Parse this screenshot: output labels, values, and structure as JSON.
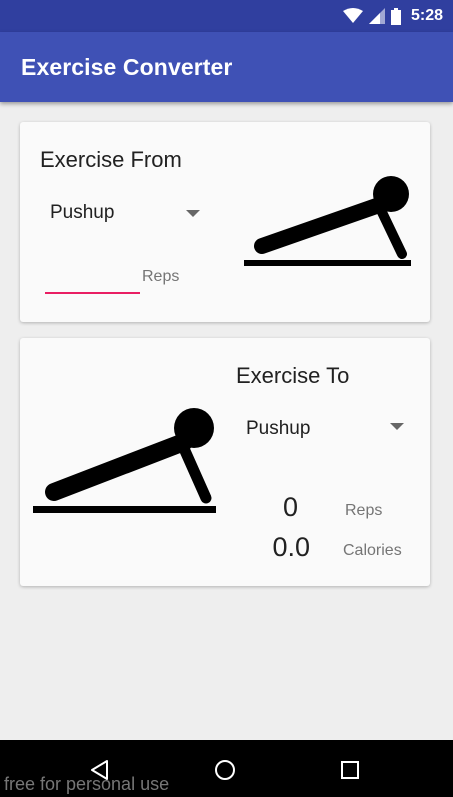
{
  "status_bar": {
    "time": "5:28",
    "icons": [
      "wifi-icon",
      "signal-icon",
      "battery-icon"
    ],
    "color": "#303f9f"
  },
  "app_bar": {
    "title": "Exercise Converter",
    "color": "#3f51b5"
  },
  "exercise_from": {
    "heading": "Exercise From",
    "selected_exercise": "Pushup",
    "reps_value": "",
    "reps_label": "Reps",
    "figure_icon": "pushup-figure-icon"
  },
  "exercise_to": {
    "heading": "Exercise To",
    "selected_exercise": "Pushup",
    "reps_value": "0",
    "reps_label": "Reps",
    "calories_value": "0.0",
    "calories_label": "Calories",
    "figure_icon": "pushup-figure-icon"
  },
  "nav_bar": {
    "buttons": [
      "back-icon",
      "home-icon",
      "recents-icon"
    ]
  },
  "watermark": "free for personal use",
  "colors": {
    "accent": "#e91e63",
    "background": "#eeeeee",
    "card": "#fafafa"
  }
}
